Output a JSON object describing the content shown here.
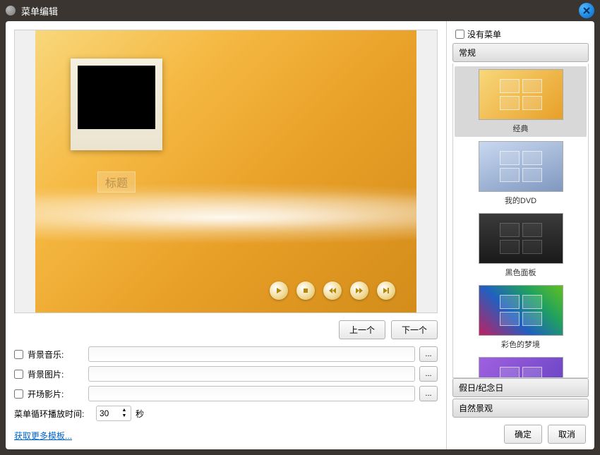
{
  "window": {
    "title": "菜单编辑"
  },
  "preview": {
    "title_placeholder": "标题"
  },
  "nav": {
    "prev": "上一个",
    "next": "下一个"
  },
  "form": {
    "bgm_label": "背景音乐:",
    "bgimg_label": "背景图片:",
    "intro_label": "开场影片:",
    "loop_label": "菜单循环播放时间:",
    "loop_value": "30",
    "loop_unit": "秒",
    "more_templates": "获取更多模板..."
  },
  "sidebar": {
    "no_menu": "没有菜单",
    "sections": {
      "general": "常规",
      "holiday": "假日/纪念日",
      "nature": "自然景观"
    },
    "templates": [
      {
        "name": "经典",
        "style": "classic",
        "selected": true
      },
      {
        "name": "我的DVD",
        "style": "mydvd",
        "selected": false
      },
      {
        "name": "黑色面板",
        "style": "black",
        "selected": false
      },
      {
        "name": "彩色的梦境",
        "style": "dream",
        "selected": false
      },
      {
        "name": "",
        "style": "purple",
        "selected": false
      }
    ]
  },
  "footer": {
    "ok": "确定",
    "cancel": "取消"
  }
}
